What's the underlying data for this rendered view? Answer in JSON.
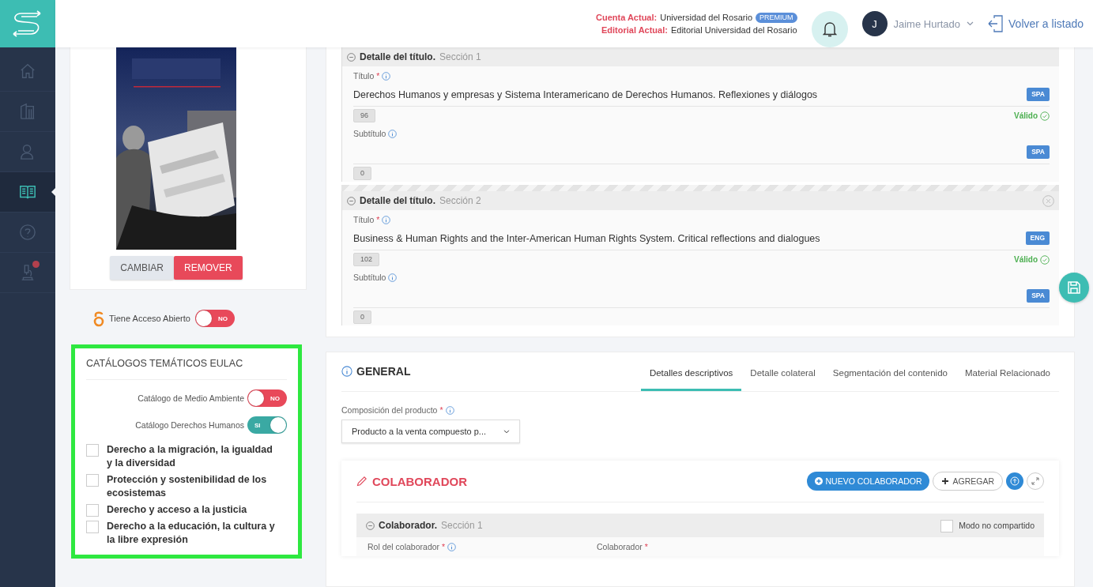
{
  "sidebar": {
    "items": [
      {
        "kind": "home",
        "selected": false
      },
      {
        "kind": "building",
        "selected": false
      },
      {
        "kind": "person",
        "selected": false
      },
      {
        "kind": "book",
        "selected": true
      },
      {
        "kind": "help",
        "selected": false
      },
      {
        "kind": "microscope",
        "selected": false,
        "badge": true
      }
    ]
  },
  "header": {
    "account_label": "Cuenta Actual:",
    "account": "Universidad del Rosario",
    "plan": "PREMIUM",
    "publisher_label": "Editorial Actual:",
    "publisher": "Editorial Universidad del Rosario",
    "user_initial": "J",
    "user_name": "Jaime Hurtado",
    "back_link": "Volver a listado"
  },
  "cover": {
    "buttons": [
      {
        "label": "CAMBIAR",
        "kind": "secondary"
      },
      {
        "label": "REMOVER",
        "kind": "danger"
      }
    ]
  },
  "open_access": {
    "label": "Tiene Acceso Abierto",
    "on": false,
    "state_text": "NO"
  },
  "catalogs": {
    "title": "CATÁLOGOS TEMÁTICOS EULAC",
    "toggles": [
      {
        "label": "Catálogo de Medio Ambiente",
        "on": false,
        "state_text": "NO"
      },
      {
        "label": "Catálogo Derechos Humanos",
        "on": true,
        "state_text": "SI"
      }
    ],
    "checkboxes": [
      {
        "label": "Derecho a la migración, la igualdad y la diversidad",
        "checked": false
      },
      {
        "label": "Protección y sostenibilidad de los ecosistemas",
        "checked": false
      },
      {
        "label": "Derecho y acceso a la justicia",
        "checked": false
      },
      {
        "label": "Derecho a la educación, la cultura y la libre expresión",
        "checked": false
      }
    ]
  },
  "title_sections": [
    {
      "title": "Detalle del título.",
      "section": "Sección 1",
      "removable": false,
      "title_field": {
        "label": "Título",
        "required_mark": "*",
        "value": "Derechos Humanos y empresas y Sistema Interamericano de Derechos Humanos. Reflexiones y diálogos",
        "lang": "SPA",
        "count": "96",
        "status": "Válido"
      },
      "subtitle_field": {
        "label": "Subtítulo",
        "lang": "SPA",
        "count": "0"
      }
    },
    {
      "title": "Detalle del título.",
      "section": "Sección 2",
      "removable": true,
      "title_field": {
        "label": "Título",
        "required_mark": "*",
        "value": "Business & Human Rights and the Inter-American Human Rights System. Critical reflections and dialogues",
        "lang": "ENG",
        "count": "102",
        "status": "Válido"
      },
      "subtitle_field": {
        "label": "Subtítulo",
        "lang": "SPA",
        "count": "0"
      }
    }
  ],
  "general": {
    "title": "GENERAL",
    "tabs": [
      {
        "label": "Detalles descriptivos",
        "selected": true
      },
      {
        "label": "Detalle colateral",
        "selected": false
      },
      {
        "label": "Segmentación del contenido",
        "selected": false
      },
      {
        "label": "Material Relacionado",
        "selected": false
      }
    ],
    "composition": {
      "label": "Composición del producto",
      "required_mark": "*",
      "value": "Producto a la venta compuesto p..."
    },
    "collaborator": {
      "title": "COLABORADOR",
      "new_button": "NUEVO COLABORADOR",
      "add_button": "AGREGAR",
      "section": {
        "title": "Colaborador.",
        "section": "Sección 1",
        "shared_label": "Modo no compartido",
        "checked": false
      },
      "fields": [
        {
          "label": "Rol del colaborador",
          "required_mark": "*",
          "info": true
        },
        {
          "label": "Colaborador",
          "required_mark": "*",
          "info": false
        }
      ]
    }
  }
}
